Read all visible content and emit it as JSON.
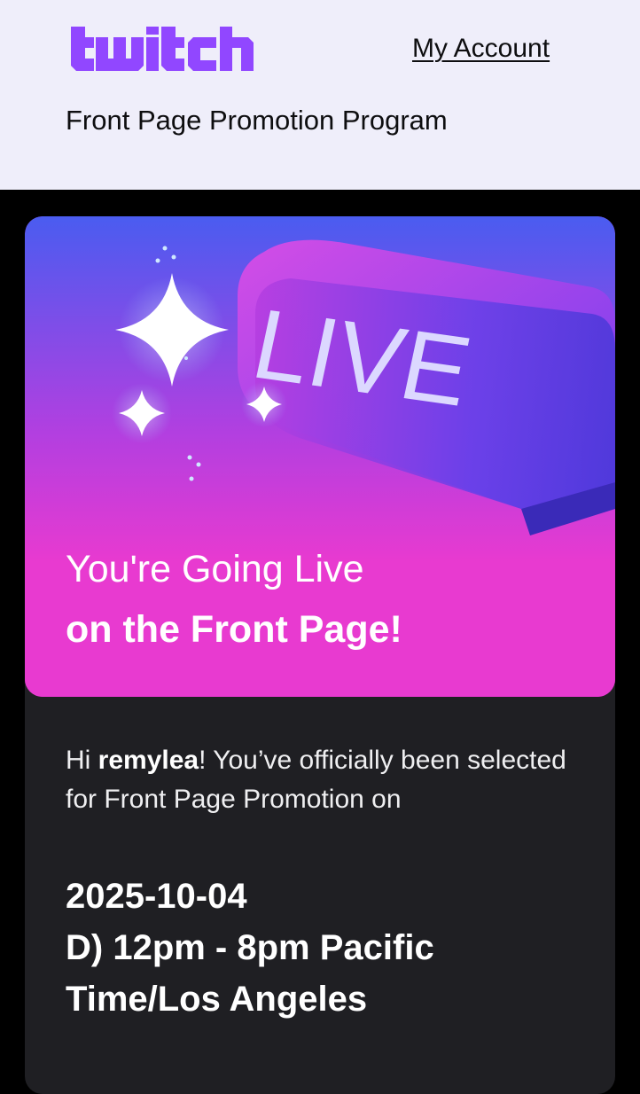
{
  "header": {
    "logo_text": "twitch",
    "account_link": "My Account",
    "program_title": "Front Page Promotion Program"
  },
  "hero": {
    "badge_text": "LIVE",
    "headline_line1": "You're Going Live",
    "headline_line2": "on the Front Page!"
  },
  "message": {
    "greeting": "Hi ",
    "username": "remylea",
    "text": "! You’ve officially been selected for Front Page Promotion on",
    "date": "2025-10-04",
    "slot_line1": "D) 12pm - 8pm Pacific",
    "slot_line2": "Time/Los Angeles"
  },
  "colors": {
    "brand_purple": "#9147ff",
    "header_bg": "#efeefa",
    "hero_pink": "#e83ad0",
    "card_bg": "#1f1f23"
  }
}
